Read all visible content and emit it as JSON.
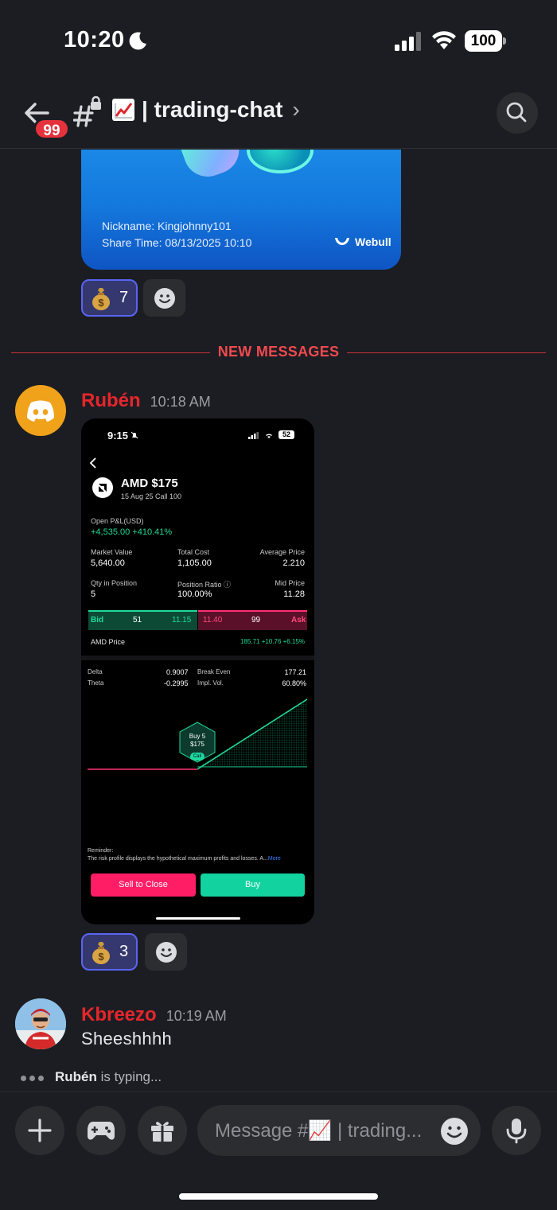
{
  "status_bar": {
    "time": "10:20",
    "battery": "100"
  },
  "header": {
    "badge_count": "99",
    "channel_name": "| trading-chat",
    "chevron": "›"
  },
  "shared_card": {
    "nickname": "Nickname: Kingjohnny101",
    "share_time": "Share Time: 08/13/2025 10:10",
    "brand": "Webull"
  },
  "reactions_1": {
    "count": "7"
  },
  "divider": {
    "label": "NEW MESSAGES"
  },
  "message_1": {
    "author": "Rubén",
    "time": "10:18 AM",
    "screenshot": {
      "time": "9:15",
      "battery": "52",
      "ticker": "AMD $175",
      "contract": "15 Aug 25 Call 100",
      "pnl_label": "Open P&L(USD)",
      "pnl_value": "+4,535.00 +410.41%",
      "market_value_label": "Market Value",
      "market_value": "5,640.00",
      "total_cost_label": "Total Cost",
      "total_cost": "1,105.00",
      "avg_price_label": "Average Price",
      "avg_price": "2.210",
      "qty_label": "Qty in Position",
      "qty": "5",
      "ratio_label": "Position Ratio ⓘ",
      "ratio": "100.00%",
      "mid_label": "Mid Price",
      "mid": "11.28",
      "bid_label": "Bid",
      "bid_size": "51",
      "bid_price": "11.15",
      "ask_price": "11.40",
      "ask_size": "99",
      "ask_label": "Ask",
      "amd_price_label": "AMD Price",
      "amd_price": "185.71 +10.76 +6.15%",
      "delta_label": "Delta",
      "delta": "0.9007",
      "theta_label": "Theta",
      "theta": "-0.2995",
      "break_even_label": "Break Even",
      "break_even": "177.21",
      "impl_vol_label": "Impl. Vol.",
      "impl_vol": "60.80%",
      "marker_line1": "Buy 5",
      "marker_line2": "$175",
      "marker_tag": "Call",
      "reminder_label": "Reminder:",
      "reminder_text": "The risk profile displays the hypothetical maximum profits and losses. A...",
      "more": "More",
      "sell_button": "Sell to Close",
      "buy_button": "Buy"
    }
  },
  "reactions_2": {
    "count": "3"
  },
  "message_2": {
    "author": "Kbreezo",
    "time": "10:19 AM",
    "text": "Sheeshhhh"
  },
  "typing": {
    "user": "Rubén",
    "suffix": "is typing..."
  },
  "composer": {
    "placeholder": "Message #📈 | trading..."
  },
  "colors": {
    "background": "#1c1d22",
    "mention_red": "#e5262c",
    "divider_red": "#ef4a4f",
    "reaction_active": "#34386e",
    "blurple": "#5865f2",
    "discord_avatar": "#f0a21b",
    "green": "#1fd99a",
    "red": "#ff2f73"
  }
}
